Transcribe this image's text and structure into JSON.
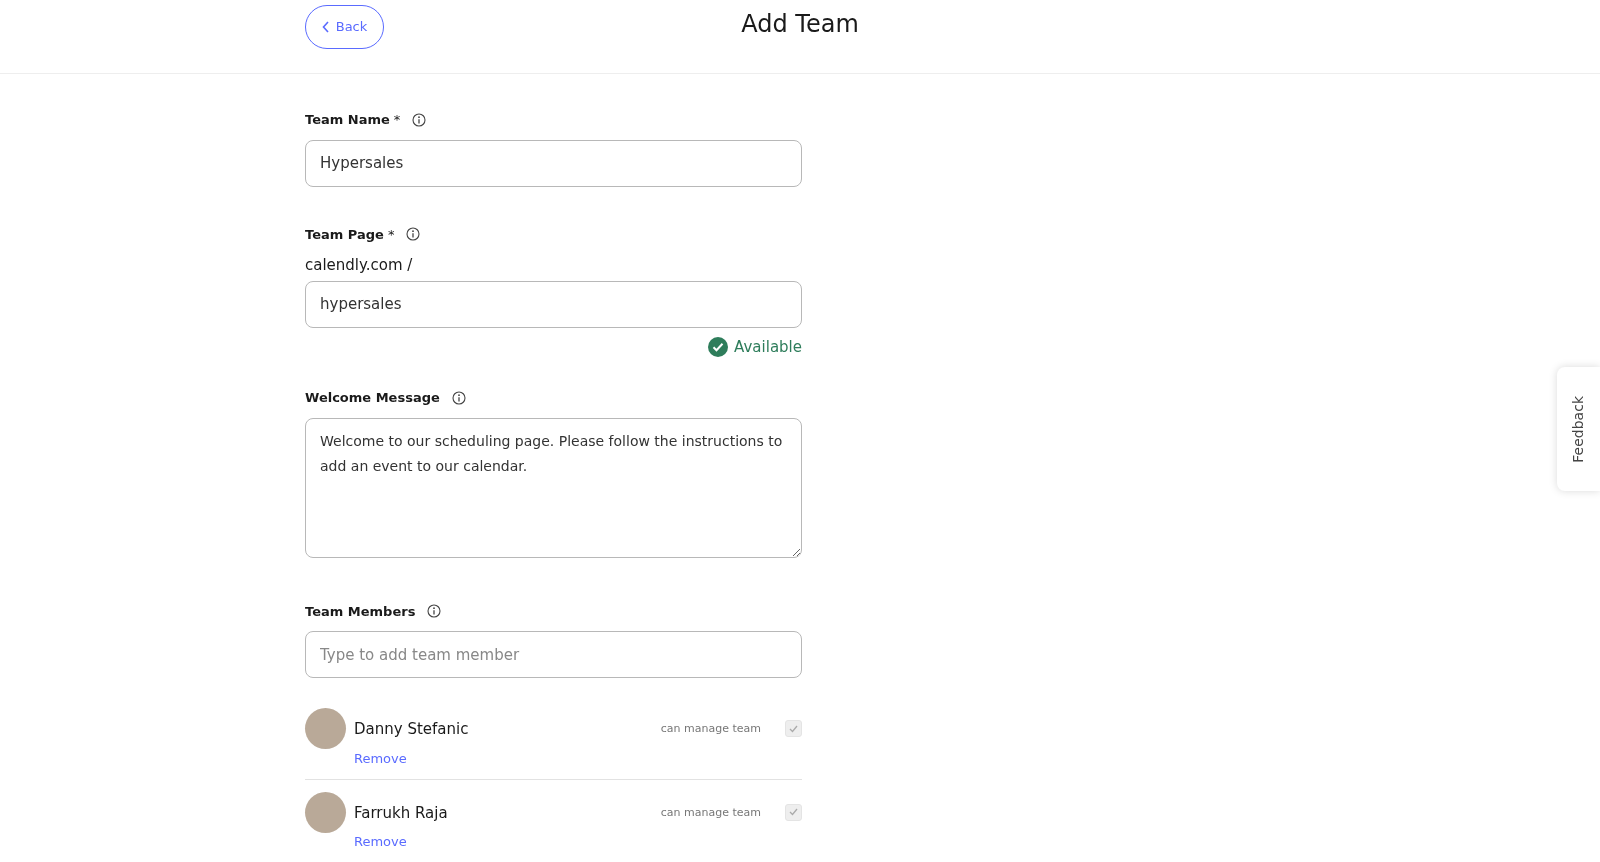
{
  "header": {
    "back_button": "Back",
    "title": "Add Team"
  },
  "fields": [
    {
      "kind": "input",
      "label": "Team Name",
      "required_mark": "*",
      "value": "Hypersales"
    },
    {
      "kind": "input",
      "label": "Team Page",
      "required_mark": "*",
      "prefix": "calendly.com /",
      "value": "hypersales",
      "status": "Available"
    },
    {
      "kind": "textarea",
      "label": "Welcome Message",
      "value": "Welcome to our scheduling page. Please follow the instructions to add an event to our calendar."
    },
    {
      "kind": "input",
      "label": "Team Members",
      "placeholder": "Type to add team member"
    }
  ],
  "members": [
    {
      "name": "Danny Stefanic",
      "action": "Remove",
      "permission_label": "can manage team",
      "checked": true,
      "disabled": true
    },
    {
      "name": "Farrukh Raja",
      "action": "Remove",
      "permission_label": "can manage team",
      "checked": true,
      "disabled": true
    }
  ],
  "feedback_tab": "Feedback"
}
